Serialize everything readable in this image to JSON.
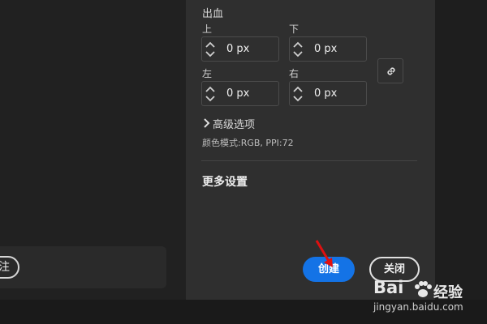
{
  "bleed": {
    "title": "出血",
    "top": {
      "label": "上",
      "value": "0 px"
    },
    "bottom": {
      "label": "下",
      "value": "0 px"
    },
    "left": {
      "label": "左",
      "value": "0 px"
    },
    "right": {
      "label": "右",
      "value": "0 px"
    },
    "link_icon": "link-icon"
  },
  "advanced": {
    "label": "高级选项",
    "icon": "chevron-right-icon"
  },
  "color_mode": "颜色模式:RGB, PPI:72",
  "more_settings": "更多设置",
  "buttons": {
    "create": "创建",
    "close": "关闭"
  },
  "left_partial_button": "注",
  "watermark": {
    "brand": "Bai",
    "brand2": "经验",
    "url": "jingyan.baidu.com"
  },
  "colors": {
    "accent": "#1473e6",
    "panel": "#2f2f2f",
    "annotation_arrow": "#e01010"
  }
}
